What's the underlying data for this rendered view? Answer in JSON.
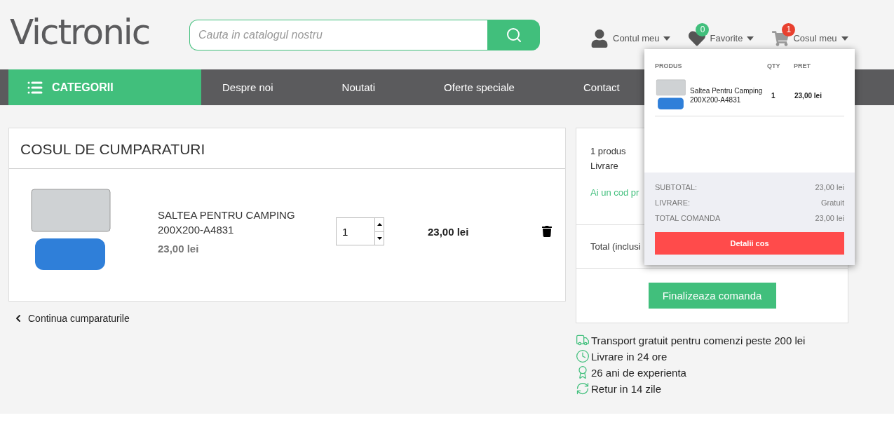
{
  "logo": {
    "text": "Victronic"
  },
  "search": {
    "placeholder": "Cauta in catalogul nostru"
  },
  "account_menu": [
    {
      "kind": "account",
      "label": "Contul meu"
    },
    {
      "kind": "favorites",
      "label": "Favorite",
      "badge": "0",
      "color": "#41bf7c"
    },
    {
      "kind": "cart",
      "label": "Cosul meu",
      "badge": "1",
      "color": "#e8402f"
    }
  ],
  "nav": {
    "categories": "CATEGORII",
    "items": [
      "Despre noi",
      "Noutati",
      "Oferte speciale",
      "Contact"
    ]
  },
  "cart": {
    "title": "COSUL DE CUMPARATURI",
    "items": [
      {
        "name": "SALTEA PENTRU CAMPING 200X200-A4831",
        "unit_price": "23,00 lei",
        "quantity": "1",
        "total": "23,00 lei"
      }
    ],
    "continue_link": "Continua cumparaturile"
  },
  "summary": {
    "rows": [
      "1 produs",
      "Livrare"
    ],
    "promo_link": "Ai un cod pr",
    "total_label": "Total (inclusi",
    "checkout_button": "Finalizeaza comanda"
  },
  "benefits": [
    {
      "kind": "truck",
      "text": "Transport gratuit pentru comenzi peste 200 lei"
    },
    {
      "kind": "clock",
      "text": "Livrare in 24 ore"
    },
    {
      "kind": "award",
      "text": "26 ani de experienta"
    },
    {
      "kind": "return",
      "text": "Retur in 14 zile"
    }
  ],
  "cart_dropdown": {
    "columns": [
      "PRODUS",
      "QTY",
      "PRET"
    ],
    "items": [
      {
        "name": "Saltea Pentru Camping 200X200-A4831",
        "quantity": "1",
        "price": "23,00 lei"
      }
    ],
    "totals": [
      {
        "label": "SUBTOTAL:",
        "value": "23,00 lei"
      },
      {
        "label": "LIVRARE:",
        "value": "Gratuit"
      },
      {
        "label": "TOTAL COMANDA",
        "value": "23,00 lei"
      }
    ],
    "button": "Detalii cos"
  }
}
